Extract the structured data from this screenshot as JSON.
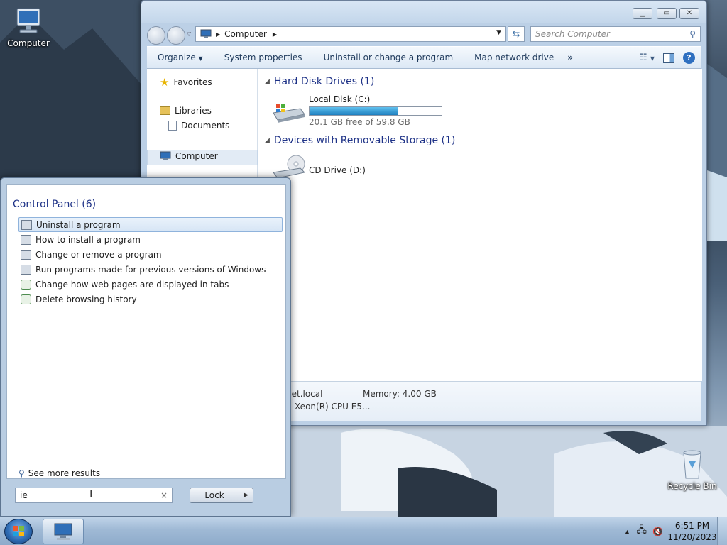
{
  "desktop": {
    "icons": [
      {
        "label": "Computer",
        "icon": "computer-icon"
      },
      {
        "label": "Recycle Bin",
        "icon": "recycle-bin-icon"
      }
    ]
  },
  "explorer": {
    "title": "",
    "address": {
      "breadcrumb": "Computer"
    },
    "search_placeholder": "Search Computer",
    "toolbar": {
      "organize": "Organize",
      "system_properties": "System properties",
      "uninstall": "Uninstall or change a program",
      "map_drive": "Map network drive",
      "more": "»"
    },
    "nav": {
      "favorites": "Favorites",
      "libraries": "Libraries",
      "documents": "Documents",
      "computer": "Computer"
    },
    "groups": {
      "hdd": "Hard Disk Drives (1)",
      "removable": "Devices with Removable Storage (1)"
    },
    "drives": {
      "c_name": "Local Disk (C:)",
      "c_free": "20.1 GB free of 59.8 GB",
      "c_used_fraction": 0.664,
      "d_name": "CD Drive (D:)"
    },
    "details": {
      "domain": "net.local",
      "memory": "Memory: 4.00 GB",
      "cpu": "Xeon(R) CPU E5..."
    }
  },
  "start_menu": {
    "header": "Control Panel (6)",
    "items": [
      "Uninstall a program",
      "How to install a program",
      "Change or remove a program",
      "Run programs made for previous versions of Windows",
      "Change how web pages are displayed in tabs",
      "Delete browsing history"
    ],
    "see_more": "See more results",
    "search_value": "ie",
    "clear": "×",
    "lock_label": "Lock"
  },
  "taskbar": {
    "time": "6:51 PM",
    "date": "11/20/2023"
  },
  "colors": {
    "accent": "#1e3287",
    "progress": "#2a8fd0"
  }
}
